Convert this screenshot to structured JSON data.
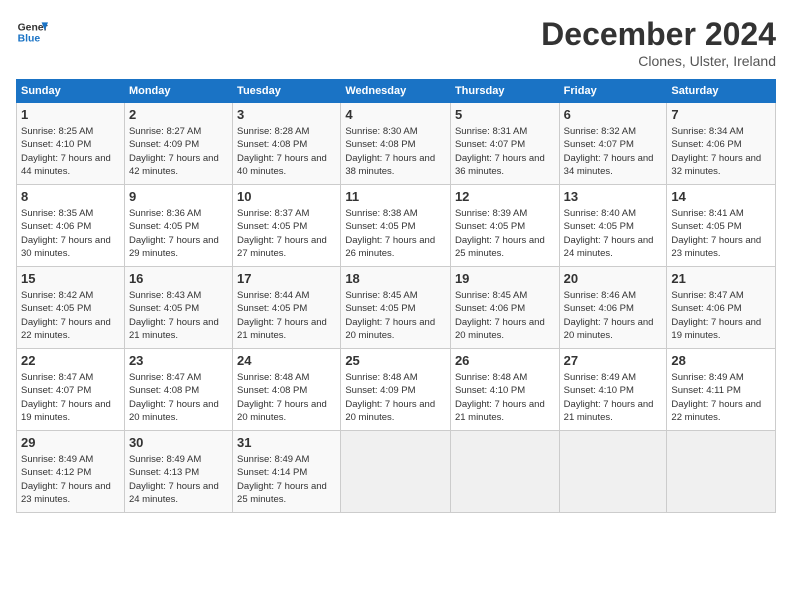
{
  "header": {
    "logo_line1": "General",
    "logo_line2": "Blue",
    "title": "December 2024",
    "subtitle": "Clones, Ulster, Ireland"
  },
  "days_of_week": [
    "Sunday",
    "Monday",
    "Tuesday",
    "Wednesday",
    "Thursday",
    "Friday",
    "Saturday"
  ],
  "weeks": [
    [
      {
        "day": "1",
        "sunrise": "8:25 AM",
        "sunset": "4:10 PM",
        "daylight": "7 hours and 44 minutes."
      },
      {
        "day": "2",
        "sunrise": "8:27 AM",
        "sunset": "4:09 PM",
        "daylight": "7 hours and 42 minutes."
      },
      {
        "day": "3",
        "sunrise": "8:28 AM",
        "sunset": "4:08 PM",
        "daylight": "7 hours and 40 minutes."
      },
      {
        "day": "4",
        "sunrise": "8:30 AM",
        "sunset": "4:08 PM",
        "daylight": "7 hours and 38 minutes."
      },
      {
        "day": "5",
        "sunrise": "8:31 AM",
        "sunset": "4:07 PM",
        "daylight": "7 hours and 36 minutes."
      },
      {
        "day": "6",
        "sunrise": "8:32 AM",
        "sunset": "4:07 PM",
        "daylight": "7 hours and 34 minutes."
      },
      {
        "day": "7",
        "sunrise": "8:34 AM",
        "sunset": "4:06 PM",
        "daylight": "7 hours and 32 minutes."
      }
    ],
    [
      {
        "day": "8",
        "sunrise": "8:35 AM",
        "sunset": "4:06 PM",
        "daylight": "7 hours and 30 minutes."
      },
      {
        "day": "9",
        "sunrise": "8:36 AM",
        "sunset": "4:05 PM",
        "daylight": "7 hours and 29 minutes."
      },
      {
        "day": "10",
        "sunrise": "8:37 AM",
        "sunset": "4:05 PM",
        "daylight": "7 hours and 27 minutes."
      },
      {
        "day": "11",
        "sunrise": "8:38 AM",
        "sunset": "4:05 PM",
        "daylight": "7 hours and 26 minutes."
      },
      {
        "day": "12",
        "sunrise": "8:39 AM",
        "sunset": "4:05 PM",
        "daylight": "7 hours and 25 minutes."
      },
      {
        "day": "13",
        "sunrise": "8:40 AM",
        "sunset": "4:05 PM",
        "daylight": "7 hours and 24 minutes."
      },
      {
        "day": "14",
        "sunrise": "8:41 AM",
        "sunset": "4:05 PM",
        "daylight": "7 hours and 23 minutes."
      }
    ],
    [
      {
        "day": "15",
        "sunrise": "8:42 AM",
        "sunset": "4:05 PM",
        "daylight": "7 hours and 22 minutes."
      },
      {
        "day": "16",
        "sunrise": "8:43 AM",
        "sunset": "4:05 PM",
        "daylight": "7 hours and 21 minutes."
      },
      {
        "day": "17",
        "sunrise": "8:44 AM",
        "sunset": "4:05 PM",
        "daylight": "7 hours and 21 minutes."
      },
      {
        "day": "18",
        "sunrise": "8:45 AM",
        "sunset": "4:05 PM",
        "daylight": "7 hours and 20 minutes."
      },
      {
        "day": "19",
        "sunrise": "8:45 AM",
        "sunset": "4:06 PM",
        "daylight": "7 hours and 20 minutes."
      },
      {
        "day": "20",
        "sunrise": "8:46 AM",
        "sunset": "4:06 PM",
        "daylight": "7 hours and 20 minutes."
      },
      {
        "day": "21",
        "sunrise": "8:47 AM",
        "sunset": "4:06 PM",
        "daylight": "7 hours and 19 minutes."
      }
    ],
    [
      {
        "day": "22",
        "sunrise": "8:47 AM",
        "sunset": "4:07 PM",
        "daylight": "7 hours and 19 minutes."
      },
      {
        "day": "23",
        "sunrise": "8:47 AM",
        "sunset": "4:08 PM",
        "daylight": "7 hours and 20 minutes."
      },
      {
        "day": "24",
        "sunrise": "8:48 AM",
        "sunset": "4:08 PM",
        "daylight": "7 hours and 20 minutes."
      },
      {
        "day": "25",
        "sunrise": "8:48 AM",
        "sunset": "4:09 PM",
        "daylight": "7 hours and 20 minutes."
      },
      {
        "day": "26",
        "sunrise": "8:48 AM",
        "sunset": "4:10 PM",
        "daylight": "7 hours and 21 minutes."
      },
      {
        "day": "27",
        "sunrise": "8:49 AM",
        "sunset": "4:10 PM",
        "daylight": "7 hours and 21 minutes."
      },
      {
        "day": "28",
        "sunrise": "8:49 AM",
        "sunset": "4:11 PM",
        "daylight": "7 hours and 22 minutes."
      }
    ],
    [
      {
        "day": "29",
        "sunrise": "8:49 AM",
        "sunset": "4:12 PM",
        "daylight": "7 hours and 23 minutes."
      },
      {
        "day": "30",
        "sunrise": "8:49 AM",
        "sunset": "4:13 PM",
        "daylight": "7 hours and 24 minutes."
      },
      {
        "day": "31",
        "sunrise": "8:49 AM",
        "sunset": "4:14 PM",
        "daylight": "7 hours and 25 minutes."
      },
      null,
      null,
      null,
      null
    ]
  ],
  "labels": {
    "sunrise": "Sunrise:",
    "sunset": "Sunset:",
    "daylight": "Daylight:"
  },
  "accent_color": "#1a73c5"
}
